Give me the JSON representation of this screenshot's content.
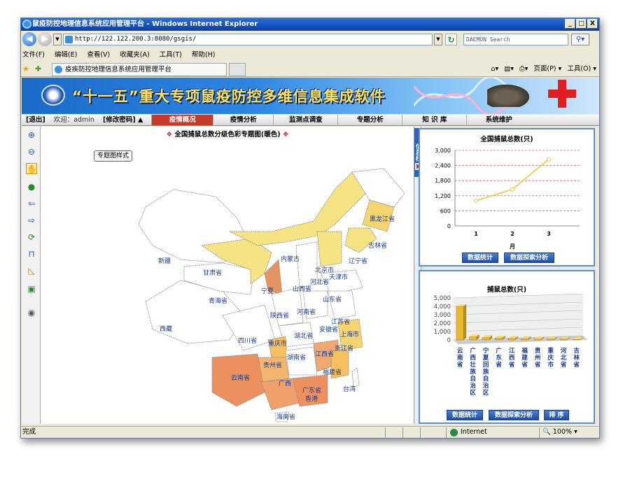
{
  "window": {
    "title": "鼠疫防控地理信息系统应用管理平台 - Windows Internet Explorer",
    "btn_min": "_",
    "btn_max": "□",
    "btn_close": "X"
  },
  "address": {
    "url": "http://122.122.200.3:8080/gsgis/",
    "search_placeholder": "DAEMON Search"
  },
  "menu": [
    "文件(F)",
    "编辑(E)",
    "查看(V)",
    "收藏夹(A)",
    "工具(T)",
    "帮助(H)"
  ],
  "tab": {
    "title": "疫疾防控地理信息系统应用管理平台"
  },
  "right_tools": {
    "page": "页面(P) ▾",
    "tools": "工具(O) ▾"
  },
  "banner": {
    "title": "“十一五”重大专项鼠疫防控多维信息集成软件"
  },
  "nav": {
    "logout": "[退出]",
    "welcome": "欢迎：admin",
    "change_pwd": "[修改密码] ▲",
    "items": [
      "疫情概况",
      "疫情分析",
      "监测点调查",
      "专题分析",
      "知 识 库",
      "系统维护"
    ]
  },
  "map": {
    "title": "全国捕鼠总数分级色彩专题图(暖色)",
    "style_button": "专题图样式",
    "provinces": [
      "黑龙江省",
      "吉林省",
      "辽宁省",
      "内蒙古",
      "新疆",
      "甘肃省",
      "北京市",
      "天津市",
      "河北省",
      "山西省",
      "宁夏",
      "青海省",
      "山东省",
      "陕西省",
      "河南省",
      "江苏省",
      "安徽省",
      "上海市",
      "西藏",
      "四川省",
      "湖北省",
      "重庆市",
      "浙江省",
      "江西省",
      "湖南省",
      "贵州省",
      "云南省",
      "广西",
      "福建省",
      "广东省",
      "台湾",
      "香港",
      "海南省"
    ]
  },
  "sidebar": {
    "label": "信息栏"
  },
  "chart_data": [
    {
      "type": "line",
      "title": "全国捕鼠总数(只)",
      "x": [
        1,
        2,
        3
      ],
      "y": [
        1000,
        1450,
        2650
      ],
      "xlabel": "月",
      "ylabel": "",
      "ylim": [
        0,
        3000
      ],
      "yticks": [
        "3,000",
        "2,400",
        "1,800",
        "1,200",
        "600",
        "0"
      ],
      "xticks": [
        "1",
        "2",
        "3"
      ],
      "color": "#f0c040"
    },
    {
      "type": "bar",
      "title": "捕鼠总数(只)",
      "categories": [
        "云南省",
        "广西壮族自治区",
        "宁夏回族自治区",
        "广东省",
        "江西省",
        "福建省",
        "贵州省",
        "重庆市",
        "河北省",
        "吉林省"
      ],
      "values": [
        4000,
        400,
        300,
        250,
        200,
        180,
        150,
        120,
        100,
        80
      ],
      "ylim": [
        0,
        5000
      ],
      "yticks": [
        "5,000",
        "4,000",
        "3,000",
        "2,000",
        "1,000",
        "0"
      ],
      "color": "#e8b830"
    }
  ],
  "panel1": {
    "btn_stats": "数据统计",
    "btn_explore": "数据探索分析"
  },
  "panel2": {
    "btn_stats": "数据统计",
    "btn_explore": "数据探索分析",
    "btn_sort": "排 序"
  },
  "status": {
    "left": "完成",
    "zone": "Internet",
    "zoom": "100%"
  }
}
